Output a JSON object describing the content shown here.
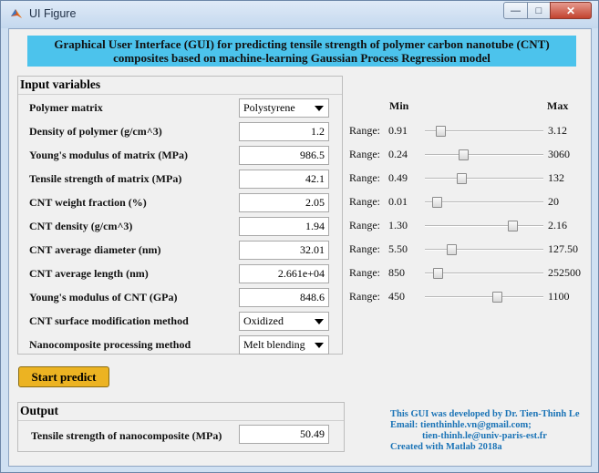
{
  "window": {
    "title": "UI Figure",
    "min_label": "—",
    "max_label": "□",
    "close_label": "✕"
  },
  "header": {
    "line1": "Graphical User Interface (GUI) for predicting tensile strength of polymer carbon nanotube (CNT)",
    "line2": "composites based on machine-learning Gaussian Process Regression model",
    "bg_color": "#4cc3ec"
  },
  "input_panel": {
    "title": "Input variables",
    "polymer_matrix": {
      "label": "Polymer matrix",
      "value": "Polystyrene"
    },
    "rows": [
      {
        "label": "Density of polymer (g/cm^3)",
        "value": "1.2",
        "range_label": "Range:",
        "min": "0.91",
        "max": "3.12",
        "slider": 0.13
      },
      {
        "label": "Young's modulus of matrix (MPa)",
        "value": "986.5",
        "range_label": "Range:",
        "min": "0.24",
        "max": "3060",
        "slider": 0.32
      },
      {
        "label": "Tensile strength of matrix (MPa)",
        "value": "42.1",
        "range_label": "Range:",
        "min": "0.49",
        "max": "132",
        "slider": 0.31
      },
      {
        "label": "CNT weight fraction (%)",
        "value": "2.05",
        "range_label": "Range:",
        "min": "0.01",
        "max": "20",
        "slider": 0.1
      },
      {
        "label": "CNT density (g/cm^3)",
        "value": "1.94",
        "range_label": "Range:",
        "min": "1.30",
        "max": "2.16",
        "slider": 0.74
      },
      {
        "label": "CNT average diameter (nm)",
        "value": "32.01",
        "range_label": "Range:",
        "min": "5.50",
        "max": "127.50",
        "slider": 0.22
      },
      {
        "label": "CNT average length (nm)",
        "value": "2.661e+04",
        "range_label": "Range:",
        "min": "850",
        "max": "252500",
        "slider": 0.11
      },
      {
        "label": "Young's modulus of CNT (GPa)",
        "value": "848.6",
        "range_label": "Range:",
        "min": "450",
        "max": "1100",
        "slider": 0.61
      }
    ],
    "surface_method": {
      "label": "CNT surface modification method",
      "value": "Oxidized"
    },
    "processing_method": {
      "label": "Nanocomposite processing method",
      "value": "Melt blending"
    }
  },
  "range_headers": {
    "min": "Min",
    "max": "Max"
  },
  "predict_button": {
    "label": "Start predict",
    "color": "#ecb322"
  },
  "output_panel": {
    "title": "Output",
    "label": "Tensile strength of nanocomposite (MPa)",
    "value": "50.49"
  },
  "credits": {
    "line1": "This GUI was developed by Dr. Tien-Thinh Le",
    "line2": "Email: tienthinhle.vn@gmail.com;",
    "line3": "tien-thinh.le@univ-paris-est.fr",
    "line4": "Created with Matlab 2018a",
    "color": "#1a73b6"
  }
}
